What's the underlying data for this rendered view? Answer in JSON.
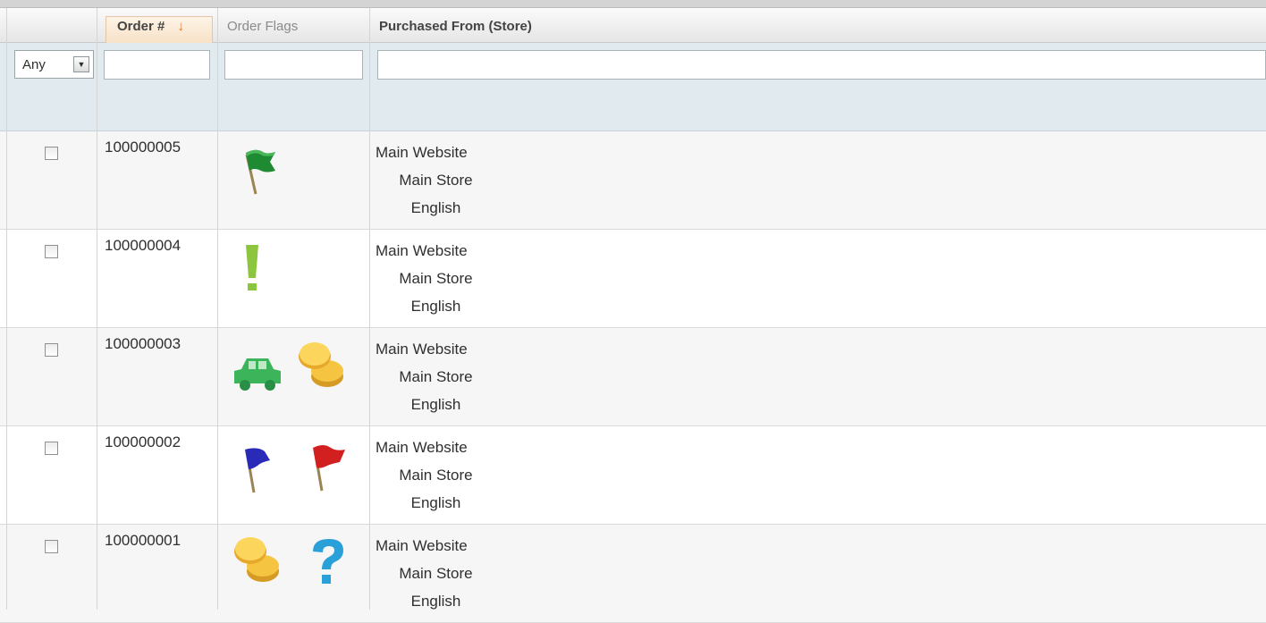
{
  "grid": {
    "columns": {
      "order_number": "Order #",
      "order_flags": "Order Flags",
      "purchased_from": "Purchased From (Store)"
    },
    "sort_arrow": "↓",
    "filter": {
      "massaction_select_value": "Any",
      "order_number_value": "",
      "order_flags_value": "",
      "store_value": ""
    },
    "rows": [
      {
        "order_number": "100000005",
        "flags": [
          "green-flag-icon"
        ],
        "store": [
          "Main Website",
          "Main Store",
          "English"
        ],
        "checked": false
      },
      {
        "order_number": "100000004",
        "flags": [
          "green-exclamation-icon"
        ],
        "store": [
          "Main Website",
          "Main Store",
          "English"
        ],
        "checked": false
      },
      {
        "order_number": "100000003",
        "flags": [
          "green-car-icon",
          "gold-coins-icon"
        ],
        "store": [
          "Main Website",
          "Main Store",
          "English"
        ],
        "checked": false
      },
      {
        "order_number": "100000002",
        "flags": [
          "blue-flag-icon",
          "red-flag-icon"
        ],
        "store": [
          "Main Website",
          "Main Store",
          "English"
        ],
        "checked": false
      },
      {
        "order_number": "100000001",
        "flags": [
          "gold-coins-icon",
          "blue-question-icon"
        ],
        "store": [
          "Main Website",
          "Main Store",
          "English"
        ],
        "checked": false
      }
    ]
  },
  "colors": {
    "header_sorted_bg": "#f7dfc3",
    "sort_arrow": "#e8732a",
    "filter_bg": "#e1ebef",
    "alt_row_bg": "#f6f6f6"
  }
}
